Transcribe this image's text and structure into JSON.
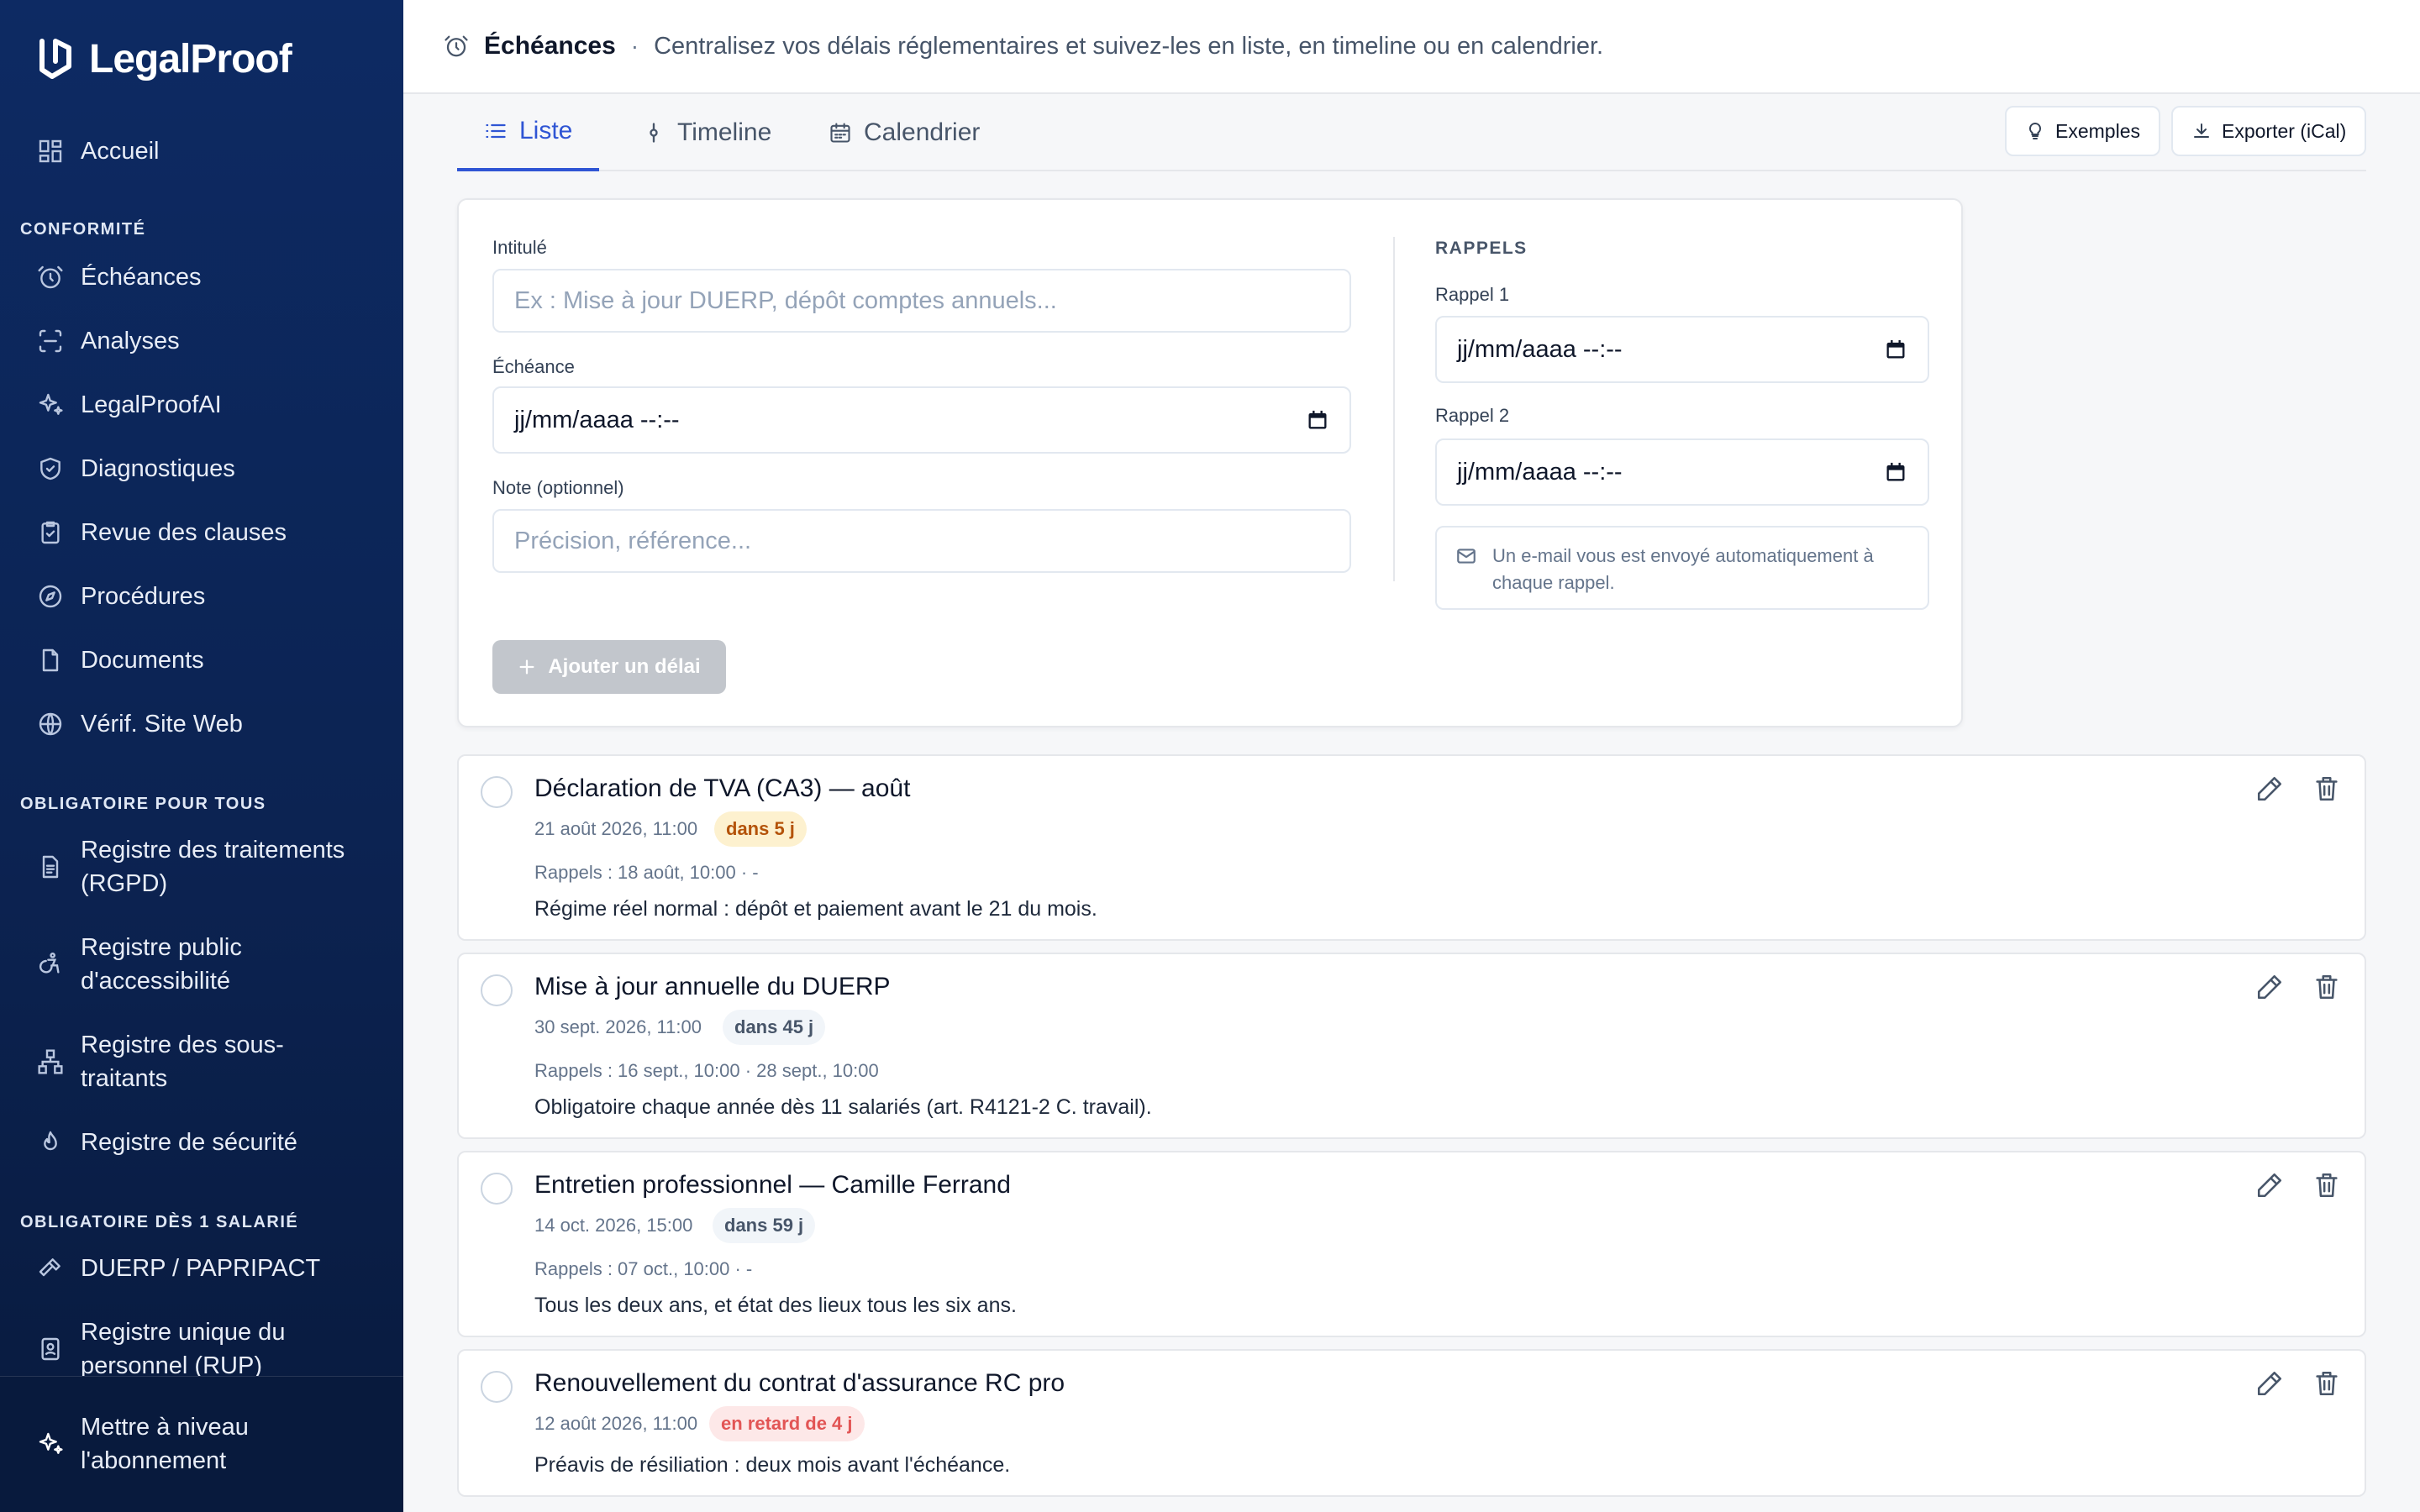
{
  "brand": {
    "name": "LegalProof"
  },
  "sidebar": {
    "home": "Accueil",
    "sections": {
      "conformite": "CONFORMITÉ",
      "obligatoire_tous": "OBLIGATOIRE POUR TOUS",
      "obligatoire_salarie": "OBLIGATOIRE DÈS 1 SALARIÉ"
    },
    "conformite_items": [
      {
        "label": "Échéances",
        "icon": "alarm-clock-icon"
      },
      {
        "label": "Analyses",
        "icon": "scan-icon"
      },
      {
        "label": "LegalProofAI",
        "icon": "sparkles-icon"
      },
      {
        "label": "Diagnostiques",
        "icon": "shield-check-icon"
      },
      {
        "label": "Revue des clauses",
        "icon": "clipboard-check-icon"
      },
      {
        "label": "Procédures",
        "icon": "compass-icon"
      },
      {
        "label": "Documents",
        "icon": "file-icon"
      },
      {
        "label": "Vérif. Site Web",
        "icon": "globe-icon"
      }
    ],
    "tous_items": [
      {
        "line1": "Registre des traitements",
        "line2": "(RGPD)",
        "icon": "file-text-icon"
      },
      {
        "line1": "Registre public",
        "line2": "d'accessibilité",
        "icon": "accessibility-icon"
      },
      {
        "line1": "Registre des sous-",
        "line2": "traitants",
        "icon": "network-icon"
      },
      {
        "line1": "Registre de sécurité",
        "line2": "",
        "icon": "flame-icon"
      }
    ],
    "salarie_items": [
      {
        "line1": "DUERP / PAPRIPACT",
        "line2": "",
        "icon": "hammer-icon"
      },
      {
        "line1": "Registre unique du",
        "line2": "personnel (RUP)",
        "icon": "id-badge-icon"
      }
    ],
    "upgrade": {
      "line1": "Mettre à niveau",
      "line2": "l'abonnement"
    }
  },
  "header": {
    "title": "Échéances",
    "separator": "·",
    "description": "Centralisez vos délais réglementaires et suivez-les en liste, en timeline ou en calendrier."
  },
  "tabs": [
    {
      "label": "Liste",
      "active": true
    },
    {
      "label": "Timeline",
      "active": false
    },
    {
      "label": "Calendrier",
      "active": false
    }
  ],
  "actions": {
    "examples": "Exemples",
    "export": "Exporter (iCal)"
  },
  "form": {
    "title_label": "Intitulé",
    "title_placeholder": "Ex : Mise à jour DUERP, dépôt comptes annuels...",
    "deadline_label": "Échéance",
    "deadline_value": "jj/mm/aaaa --:--",
    "note_label": "Note (optionnel)",
    "note_placeholder": "Précision, référence...",
    "rappels_title": "RAPPELS",
    "rappel1_label": "Rappel 1",
    "rappel1_value": "jj/mm/aaaa --:--",
    "rappel2_label": "Rappel 2",
    "rappel2_value": "jj/mm/aaaa --:--",
    "info": "Un e-mail vous est envoyé automatiquement à chaque rappel.",
    "add_button": "Ajouter un délai"
  },
  "deadlines": [
    {
      "title": "Déclaration de TVA (CA3) — août",
      "date": "21 août 2026, 11:00",
      "badge": "dans 5 j",
      "status": "warn",
      "rappels": "Rappels : 18 août, 10:00 · -",
      "note": "Régime réel normal : dépôt et paiement avant le 21 du mois."
    },
    {
      "title": "Mise à jour annuelle du DUERP",
      "date": "30 sept. 2026, 11:00",
      "badge": "dans 45 j",
      "status": "neutral",
      "rappels": "Rappels : 16 sept., 10:00 · 28 sept., 10:00",
      "note": "Obligatoire chaque année dès 11 salariés (art. R4121-2 C. travail)."
    },
    {
      "title": "Entretien professionnel — Camille Ferrand",
      "date": "14 oct. 2026, 15:00",
      "badge": "dans 59 j",
      "status": "neutral",
      "rappels": "Rappels : 07 oct., 10:00 · -",
      "note": "Tous les deux ans, et état des lieux tous les six ans."
    },
    {
      "title": "Renouvellement du contrat d'assurance RC pro",
      "date": "12 août 2026, 11:00",
      "badge": "en retard de 4 j",
      "status": "late",
      "rappels": "",
      "note": "Préavis de résiliation : deux mois avant l'échéance."
    }
  ],
  "colors": {
    "accent": "#2f55d4",
    "sidebar": "#0c2352",
    "warn": "#b45309",
    "late": "#e25555"
  }
}
